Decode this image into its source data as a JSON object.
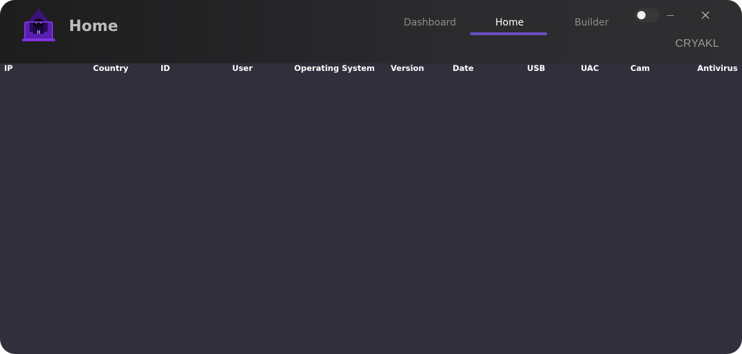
{
  "window": {
    "title": "Home",
    "brand": "CRYAKL",
    "tabs": [
      {
        "label": "Dashboard",
        "active": false
      },
      {
        "label": "Home",
        "active": true
      },
      {
        "label": "Builder",
        "active": false
      }
    ],
    "theme_toggle": {
      "on": false
    },
    "colors": {
      "background": "#312f3c",
      "titlebar": "#252527",
      "accent": "#6a4fc6",
      "logo_purple": "#7b2fd6"
    }
  },
  "table": {
    "columns": [
      "IP",
      "Country",
      "ID",
      "User",
      "Operating System",
      "Version",
      "Date",
      "USB",
      "UAC",
      "Cam",
      "Antivirus"
    ],
    "rows": []
  },
  "icons": {
    "logo": "hacker-laptop-logo-icon",
    "minimize": "minimize-icon",
    "close": "close-icon"
  }
}
